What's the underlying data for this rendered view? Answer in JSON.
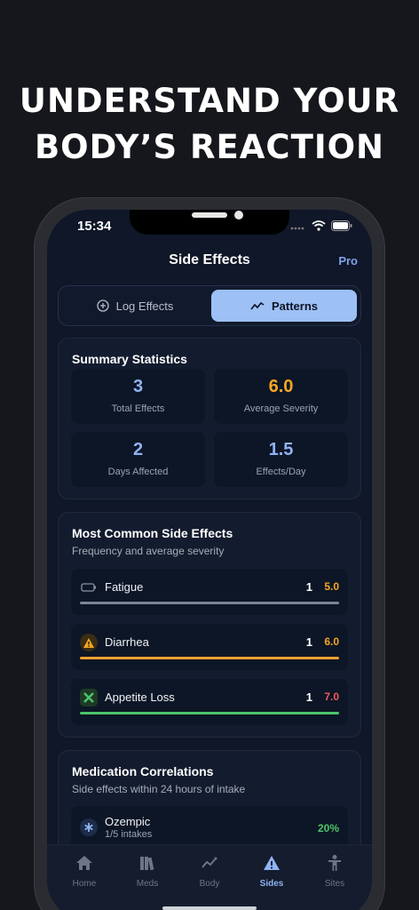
{
  "headline": {
    "line1": "UNDERSTAND YOUR",
    "line2": "BODY’S REACTION"
  },
  "status": {
    "time": "15:34"
  },
  "nav": {
    "title": "Side Effects",
    "pro": "Pro"
  },
  "segments": [
    {
      "label": "Log Effects",
      "icon": "plus-circle-icon"
    },
    {
      "label": "Patterns",
      "icon": "trend-line-icon"
    }
  ],
  "summary": {
    "title": "Summary Statistics",
    "stats": [
      {
        "value": "3",
        "label": "Total Effects",
        "color": "#8fb3f3"
      },
      {
        "value": "6.0",
        "label": "Average Severity",
        "color": "#f5a623"
      },
      {
        "value": "2",
        "label": "Days Affected",
        "color": "#8fb3f3"
      },
      {
        "value": "1.5",
        "label": "Effects/Day",
        "color": "#8fb3f3"
      }
    ]
  },
  "common": {
    "title": "Most Common Side Effects",
    "subtitle": "Frequency and average severity",
    "items": [
      {
        "name": "Fatigue",
        "count": "1",
        "severity": "5.0",
        "severity_color": "#f5a623",
        "bar_color": "#7b8594",
        "icon": "battery-icon"
      },
      {
        "name": "Diarrhea",
        "count": "1",
        "severity": "6.0",
        "severity_color": "#f5a623",
        "bar_color": "#f0a030",
        "icon": "warning-icon"
      },
      {
        "name": "Appetite Loss",
        "count": "1",
        "severity": "7.0",
        "severity_color": "#f05a5a",
        "bar_color": "#4cc46a",
        "icon": "utensils-cross-icon"
      }
    ]
  },
  "correlations": {
    "title": "Medication Correlations",
    "subtitle": "Side effects within 24 hours of intake",
    "items": [
      {
        "name": "Ozempic",
        "detail": "1/5 intakes",
        "percent": "20%",
        "percent_color": "#4cc46a",
        "icon": "asterisk-icon"
      }
    ]
  },
  "tabs": [
    {
      "label": "Home",
      "icon": "home-icon"
    },
    {
      "label": "Meds",
      "icon": "books-icon"
    },
    {
      "label": "Body",
      "icon": "chart-line-icon"
    },
    {
      "label": "Sides",
      "icon": "warning-icon",
      "active": true
    },
    {
      "label": "Sites",
      "icon": "person-icon"
    }
  ]
}
